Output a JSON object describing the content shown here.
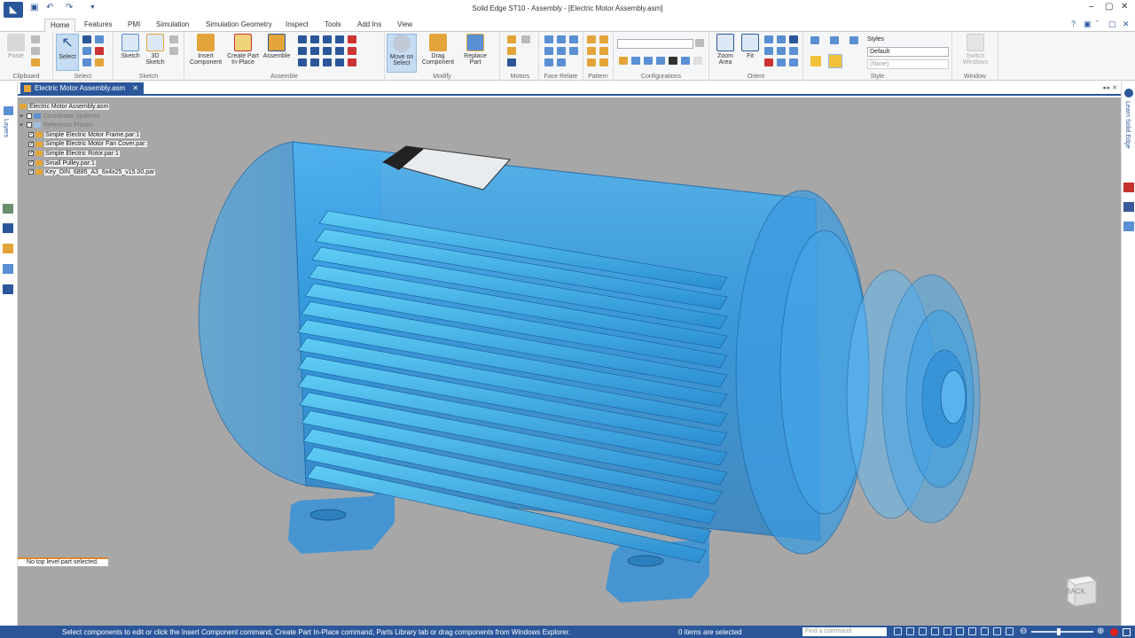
{
  "window": {
    "title": "Solid Edge ST10 - Assembly - [Electric Motor Assembly.asm]",
    "quick_access": [
      "save-icon",
      "undo-icon",
      "redo-icon",
      "customize-icon"
    ],
    "controls": [
      "minimize",
      "restore",
      "close"
    ]
  },
  "tabs": [
    "Home",
    "Features",
    "PMI",
    "Simulation",
    "Simulation Geometry",
    "Inspect",
    "Tools",
    "Add Ins",
    "View"
  ],
  "active_tab": "Home",
  "ribbon": {
    "clipboard": {
      "paste": "Paste",
      "label": "Clipboard"
    },
    "select": {
      "select": "Select",
      "label": "Select"
    },
    "sketch": {
      "sketch": "Sketch",
      "sketch3d_l1": "3D",
      "sketch3d_l2": "Sketch",
      "label": "Sketch"
    },
    "assemble": {
      "insert_l1": "Insert",
      "insert_l2": "Component",
      "create_l1": "Create Part",
      "create_l2": "In-Place",
      "assemble": "Assemble",
      "label": "Assemble"
    },
    "modify": {
      "move_l1": "Move on",
      "move_l2": "Select",
      "drag_l1": "Drag",
      "drag_l2": "Component",
      "replace_l1": "Replace",
      "replace_l2": "Part",
      "label": "Modify"
    },
    "motors": {
      "label": "Motors"
    },
    "face_relate": {
      "label": "Face Relate"
    },
    "pattern": {
      "label": "Pattern"
    },
    "configurations": {
      "label": "Configurations"
    },
    "orient": {
      "zoom_l1": "Zoom",
      "zoom_l2": "Area",
      "fit": "Fit",
      "label": "Orient"
    },
    "style": {
      "styles": "Styles",
      "style_value": "Default",
      "none_value": "(None)",
      "label": "Style"
    },
    "window": {
      "switch_l1": "Switch",
      "switch_l2": "Windows",
      "label": "Window"
    }
  },
  "document_tab": "Electric Motor Assembly.asm",
  "side_panel_labels": {
    "layers": "Layers",
    "learn": "Learn Solid Edge"
  },
  "tree": {
    "root": "Electric Motor Assembly.asm",
    "items": [
      {
        "label": "Coordinate Systems",
        "checked": false,
        "expandable": true,
        "dim": true
      },
      {
        "label": "Reference Planes",
        "checked": false,
        "expandable": true,
        "dim": true
      },
      {
        "label": "Simple Electric Motor Frame.par:1",
        "checked": true,
        "expandable": false,
        "dim": false
      },
      {
        "label": "Simple Electric Motor Fan Cover.par:",
        "checked": true,
        "expandable": false,
        "dim": false
      },
      {
        "label": "Simple Electric Rotor.par:1",
        "checked": true,
        "expandable": false,
        "dim": false
      },
      {
        "label": "Small Pulley.par:1",
        "checked": true,
        "expandable": false,
        "dim": false
      },
      {
        "label": "Key_DIN_6885_A3_6x4x25_v15.00.par",
        "checked": true,
        "expandable": false,
        "dim": false
      }
    ]
  },
  "selection_tip": "No top level part selected.",
  "view_cube": {
    "label": "BACK"
  },
  "status": {
    "prompt": "Select components to edit or click the Insert Component command, Create Part In-Place command, Parts Library tab or drag components from Windows Explorer.",
    "items_selected": "0 items are selected",
    "find_placeholder": "Find a command"
  },
  "colors": {
    "accent": "#2b579a",
    "viewport_bg": "#a7a7a7",
    "motor_blue": "#3a9de0"
  }
}
